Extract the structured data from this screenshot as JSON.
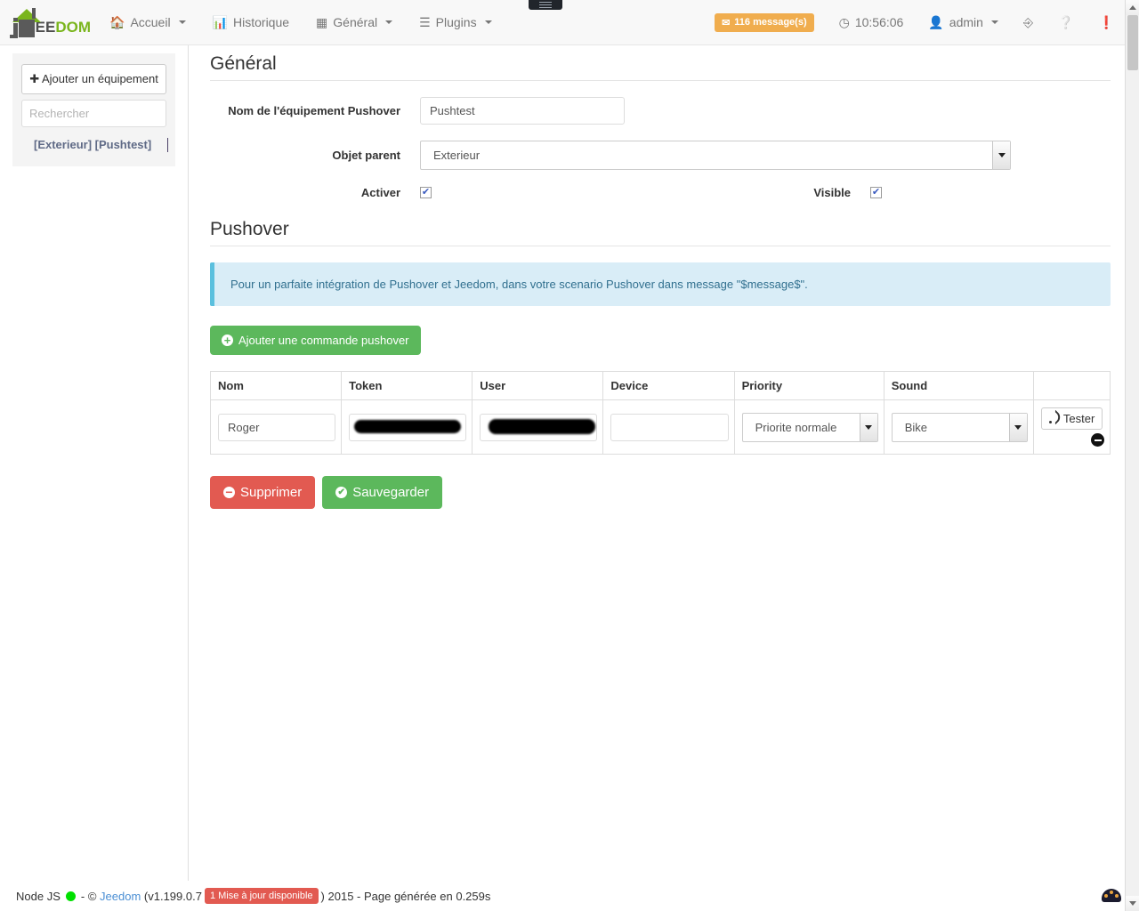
{
  "navbar": {
    "brand": {
      "ee": "EE",
      "dom": "DOM"
    },
    "left_items": [
      {
        "label": "Accueil",
        "icon": "home-icon",
        "caret": true
      },
      {
        "label": "Historique",
        "icon": "chart-bar-icon",
        "caret": false
      },
      {
        "label": "Général",
        "icon": "grid-icon",
        "caret": true
      },
      {
        "label": "Plugins",
        "icon": "list-icon",
        "caret": true
      }
    ],
    "messages_badge": "116 message(s)",
    "clock": "10:56:06",
    "user": "admin",
    "icons": [
      "sitemap-icon",
      "help-icon",
      "info-icon"
    ]
  },
  "sidebar": {
    "add_button": "Ajouter un équipement",
    "search_placeholder": "Rechercher",
    "search_value": "",
    "items": [
      {
        "label": "[Exterieur] [Pushtest]"
      }
    ]
  },
  "main": {
    "general_legend": "Général",
    "pushover_legend": "Pushover",
    "fields": {
      "name_label": "Nom de l'équipement Pushover",
      "name_value": "Pushtest",
      "parent_label": "Objet parent",
      "parent_value": "Exterieur",
      "activer_label": "Activer",
      "activer_checked": true,
      "visible_label": "Visible",
      "visible_checked": true
    },
    "alert_text": "Pour un parfaite intégration de Pushover et Jeedom, dans votre scenario Pushover dans message \"$message$\".",
    "add_command_button": "Ajouter une commande pushover",
    "table": {
      "headers": [
        "Nom",
        "Token",
        "User",
        "Device",
        "Priority",
        "Sound",
        ""
      ],
      "rows": [
        {
          "nom": "Roger",
          "token": "",
          "token_redacted": true,
          "user": "",
          "user_redacted": true,
          "device": "",
          "priority": "Priorite normale",
          "sound": "Bike",
          "test_button": "Tester"
        }
      ]
    },
    "delete_button": "Supprimer",
    "save_button": "Sauvegarder"
  },
  "footer": {
    "node_js": "Node JS",
    "copyright_prefix": "- ©",
    "jeedom_link": "Jeedom",
    "version_open": "(v1.199.0.7",
    "update_badge": "1 Mise à jour disponible",
    "version_close": ")",
    "year_and_time": "2015 - Page générée en 0.259s"
  },
  "colors": {
    "accent_green": "#7ab51d",
    "btn_green": "#5cb85c",
    "btn_red": "#e25a51",
    "badge_orange": "#f0ad4e",
    "alert_bg": "#d9edf7",
    "alert_border": "#5bc0de",
    "link_blue": "#4b8fd4"
  }
}
